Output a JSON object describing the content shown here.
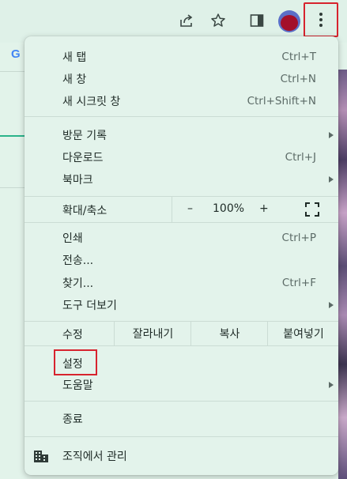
{
  "toolbar": {
    "icons": [
      "share-icon",
      "star-icon",
      "side-panel-icon",
      "profile-avatar",
      "more-vert-icon"
    ]
  },
  "background_page": {
    "logo_letter": "G"
  },
  "menu": {
    "group1": [
      {
        "label": "새 탭",
        "shortcut": "Ctrl+T"
      },
      {
        "label": "새 창",
        "shortcut": "Ctrl+N"
      },
      {
        "label": "새 시크릿 창",
        "shortcut": "Ctrl+Shift+N"
      }
    ],
    "group2": [
      {
        "label": "방문 기록",
        "shortcut": ""
      },
      {
        "label": "다운로드",
        "shortcut": "Ctrl+J"
      },
      {
        "label": "북마크",
        "shortcut": ""
      }
    ],
    "zoom": {
      "label": "확대/축소",
      "minus": "–",
      "value": "100%",
      "plus": "+"
    },
    "group3": [
      {
        "label": "인쇄",
        "shortcut": "Ctrl+P"
      },
      {
        "label": "전송...",
        "shortcut": ""
      },
      {
        "label": "찾기...",
        "shortcut": "Ctrl+F"
      },
      {
        "label": "도구 더보기",
        "shortcut": ""
      }
    ],
    "edit": {
      "label": "수정",
      "cut": "잘라내기",
      "copy": "복사",
      "paste": "붙여넣기"
    },
    "group4": [
      {
        "label": "설정",
        "shortcut": ""
      },
      {
        "label": "도움말",
        "shortcut": ""
      }
    ],
    "exit": {
      "label": "종료"
    },
    "managed": {
      "label": "조직에서 관리"
    }
  },
  "colors": {
    "highlight": "#d7232e",
    "menu_bg": "#e3f3eb",
    "accent_green": "#2ab38a"
  }
}
